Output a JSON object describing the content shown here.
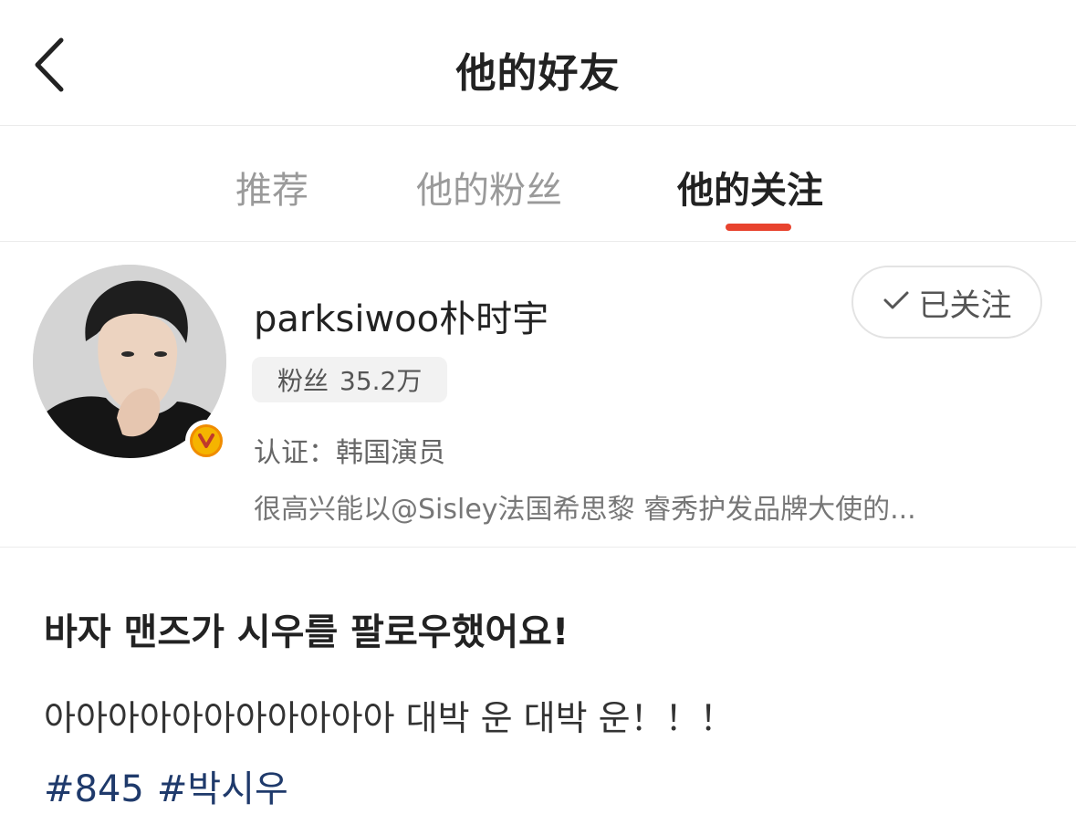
{
  "navbar": {
    "title": "他的好友",
    "back_icon": "chevron-left-icon"
  },
  "tabs": [
    {
      "label": "推荐",
      "active": false
    },
    {
      "label": "他的粉丝",
      "active": false
    },
    {
      "label": "他的关注",
      "active": true
    }
  ],
  "colors": {
    "accent": "#e8432e",
    "hashtag": "#1f3a6b",
    "verified_badge": "#f5b400"
  },
  "user": {
    "name": "parksiwoo朴时宇",
    "avatar_icon": "avatar-photo",
    "verified_icon": "verified-v-icon",
    "follow_button": {
      "icon": "check-icon",
      "label": "已关注"
    },
    "fans": {
      "label": "粉丝",
      "count": "35.2万"
    },
    "certification": "认证：韩国演员",
    "bio": "很高兴能以@Sisley法国希思黎 睿秀护发品牌大使的..."
  },
  "post": {
    "title": "바자 맨즈가 시우를 팔로우했어요!",
    "body": "아아아아아아아아아아아 대박 운 대박 운！！！",
    "hashtags": [
      "#845",
      "#박시우"
    ]
  }
}
